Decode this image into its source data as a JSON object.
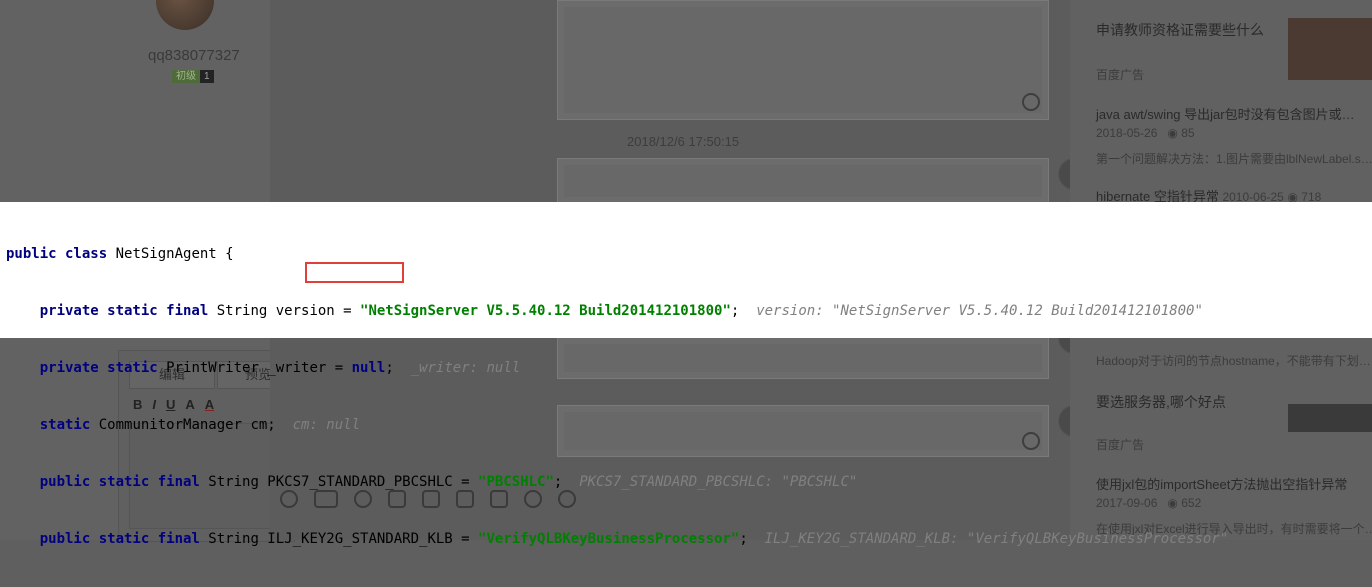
{
  "profile": {
    "username": "qq838077327",
    "level_label": "初级",
    "level_number": "1"
  },
  "chat": {
    "timestamp": "2018/12/6 17:50:15"
  },
  "editor": {
    "tab_edit": "编辑",
    "tab_preview": "预览",
    "fmt_bold": "B",
    "fmt_italic": "I",
    "fmt_underline": "U",
    "fmt_font": "A",
    "fmt_color": "A"
  },
  "right_sidebar": {
    "items": [
      {
        "title": "申请教师资格证需要些什么",
        "meta": "百度广告"
      },
      {
        "title": "java awt/swing 导出jar包时没有包含图片或…",
        "meta": "2018-05-26",
        "views": "85",
        "snippet": "第一个问题解决方法：1.图片需要由lblNewLabel.s…"
      },
      {
        "title": "hibernate 空指针异常",
        "meta": "2010-06-25",
        "views": "718"
      },
      {
        "title": "Hadoop对于访问的节点hostname，不能带有下划…"
      },
      {
        "title": "要选服务器,哪个好点",
        "meta": "百度广告"
      },
      {
        "title": "使用jxl包的importSheet方法抛出空指针异常",
        "meta": "2017-09-06",
        "views": "652",
        "snippet": "在使用jxl对Excel进行导入导出时，有时需要将一个…"
      }
    ]
  },
  "code": {
    "l1_kw": "public class",
    "l1_rest": " NetSignAgent {",
    "l2_kw": "private static final",
    "l2_rest": " String version = ",
    "l2_str": "\"NetSignServer V5.5.40.12 Build201412101800\"",
    "l2_hint": "version: \"NetSignServer V5.5.40.12 Build201412101800\"",
    "l3_kw": "private static",
    "l3_rest": " PrintWriter _writer = ",
    "l3_null": "null",
    "l3_hint": "_writer: null",
    "l4_kw": "static",
    "l4_rest": " CommunitorManager cm;",
    "l4_hint": "cm: null",
    "l5_kw": "public static final",
    "l5_rest": " String PKCS7_STANDARD_PBCSHLC = ",
    "l5_str": "\"PBCSHLC\"",
    "l5_hint": "PKCS7_STANDARD_PBCSHLC: \"PBCSHLC\"",
    "l6_kw": "public static final",
    "l6_rest": " String ILJ_KEY2G_STANDARD_KLB = ",
    "l6_str": "\"VerifyQLBKeyBusinessProcessor\"",
    "l6_hint": "ILJ_KEY2G_STANDARD_KLB: \"VerifyQLBKeyBusinessProcessor\""
  },
  "colors": {
    "keyword": "#000080",
    "string": "#008000",
    "hint": "#808080",
    "highlight_box": "#e0403a"
  }
}
